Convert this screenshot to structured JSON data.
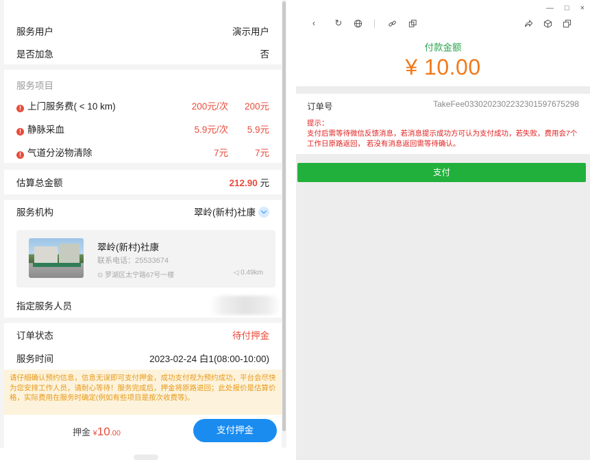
{
  "left": {
    "service_user": {
      "label": "服务用户",
      "value": "演示用户"
    },
    "urgent": {
      "label": "是否加急",
      "value": "否"
    },
    "items_title": "服务项目",
    "items": [
      {
        "name": "上门服务费( < 10 km)",
        "price": "200元/次",
        "subtotal": "200元"
      },
      {
        "name": "静脉采血",
        "price": "5.9元/次",
        "subtotal": "5.9元"
      },
      {
        "name": "气道分泌物清除",
        "price": "7元",
        "subtotal": "7元"
      }
    ],
    "item_icon": "!",
    "total": {
      "label": "估算总金额",
      "value": "212.90",
      "unit": "元"
    },
    "org": {
      "label": "服务机构",
      "selected": "翠岭(新村)社康"
    },
    "org_card": {
      "name": "翠岭(新村)社康",
      "phone": "联系电话：25533674",
      "address": "⊙ 罗湖区太宁路67号一楼",
      "distance": "◁ 0.49km"
    },
    "staff": {
      "label": "指定服务人员"
    },
    "order_status": {
      "label": "订单状态",
      "value": "待付押金"
    },
    "service_time": {
      "label": "服务时间",
      "value": "2023-02-24 白1(08:00-10:00)"
    },
    "notice": "请仔细确认预约信息，信息无误即可支付押金，成功支付视为预约成功，平台会尽快为您安排工作人员，请耐心等待！服务完成后，押金将原路退回；此处报价是估算价格，实际费用在服务时确定(例如有些项目是按次收费等)。",
    "deposit": {
      "label": "押金",
      "currency": "¥",
      "amount": "10",
      "decimal": ".00"
    },
    "pay_deposit_button": "支付押金"
  },
  "right": {
    "window_controls": [
      "—",
      "□",
      "×"
    ],
    "toolbar_icons": [
      "back-icon",
      "refresh-icon",
      "globe-icon",
      "link-icon",
      "copy-icon",
      "share-icon",
      "cube-icon",
      "window-icon"
    ],
    "pay_amount_label": "付款金额",
    "pay_amount": "¥ 10.00",
    "order_label": "订单号",
    "order_no": "TakeFee0330202302232301597675298",
    "hint_title": "提示：",
    "hint_body": "支付后需等待微信反馈消息，若消息提示成功方可认为支付成功，若失败，费用会7个工作日原路返回， 若没有消息返回需等待确认。",
    "pay_button": "支付"
  },
  "colors": {
    "accent_blue": "#1a8cf0",
    "danger_red": "#e94b3c",
    "wechat_green": "#22b03c",
    "amount_orange": "#f07a1b",
    "notice_bg": "#fdf3dc",
    "notice_text": "#e89a1a"
  }
}
